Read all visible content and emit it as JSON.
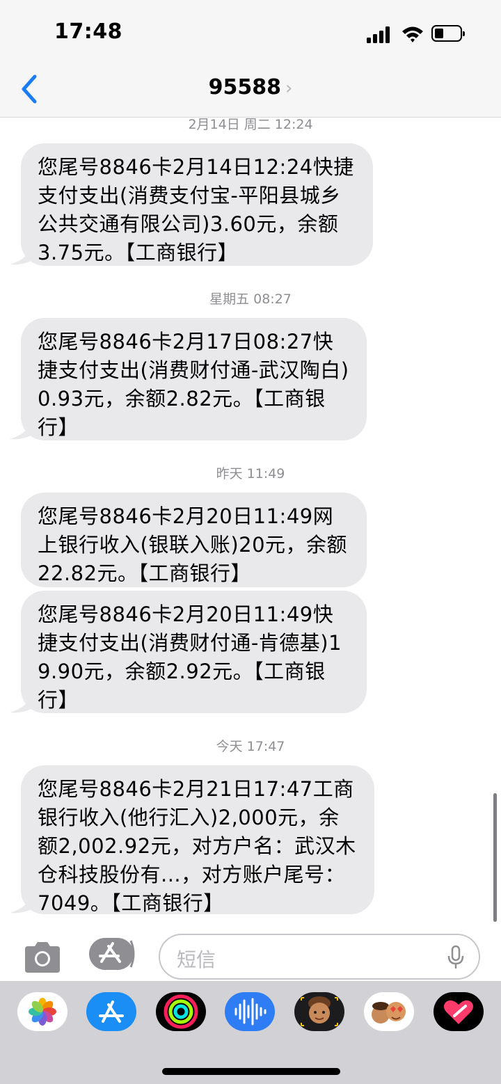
{
  "status": {
    "time": "17:48"
  },
  "nav": {
    "title": "95588",
    "chevron": "›",
    "back_icon": "chevron-left-icon"
  },
  "messages": [
    {
      "timestamp": "2月14日 周二 12:24",
      "bubbles": [
        "您尾号8846卡2月14日12:24快捷支付支出(消费支付宝-平阳县城乡公共交通有限公司)3.60元，余额3.75元。【工商银行】"
      ]
    },
    {
      "timestamp": "星期五 08:27",
      "bubbles": [
        "您尾号8846卡2月17日08:27快捷支付支出(消费财付通-武汉陶白)0.93元，余额2.82元。【工商银行】"
      ]
    },
    {
      "timestamp": "昨天 11:49",
      "bubbles": [
        "您尾号8846卡2月20日11:49网上银行收入(银联入账)20元，余额22.82元。【工商银行】",
        "您尾号8846卡2月20日11:49快捷支付支出(消费财付通-肯德基)19.90元，余额2.92元。【工商银行】"
      ]
    },
    {
      "timestamp": "今天 17:47",
      "bubbles": [
        "您尾号8846卡2月21日17:47工商银行收入(他行汇入)2,000元，余额2,002.92元，对方户名：武汉木仓科技股份有...，对方账户尾号：7049。【工商银行】"
      ]
    }
  ],
  "composer": {
    "placeholder": "短信",
    "camera_icon": "camera-icon",
    "apps_icon": "app-store-icon",
    "mic_icon": "microphone-icon"
  },
  "app_drawer": [
    "photos-icon",
    "app-store-icon",
    "activity-icon",
    "audio-message-icon",
    "memoji-icon",
    "memoji-stickers-icon",
    "digital-touch-icon"
  ],
  "colors": {
    "bubble": "#e9e9eb",
    "accent": "#1a7cf5",
    "timestamp": "#8e8e93"
  }
}
